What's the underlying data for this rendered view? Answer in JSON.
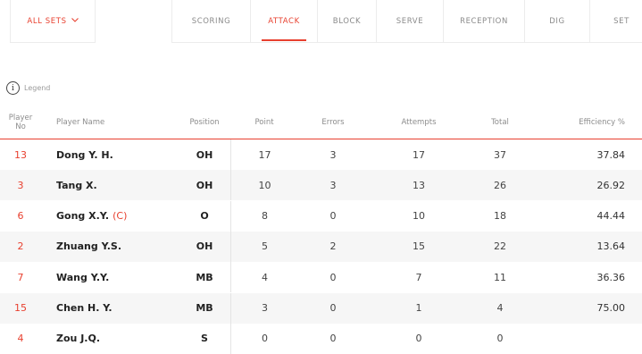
{
  "filter": {
    "label": "ALL SETS"
  },
  "tabs": [
    {
      "label": "SCORING"
    },
    {
      "label": "ATTACK"
    },
    {
      "label": "BLOCK"
    },
    {
      "label": "SERVE"
    },
    {
      "label": "RECEPTION"
    },
    {
      "label": "DIG"
    },
    {
      "label": "SET"
    }
  ],
  "active_tab": "ATTACK",
  "legend": {
    "label": "Legend",
    "icon": "info-icon"
  },
  "columns": {
    "no": "Player No",
    "name": "Player Name",
    "position": "Position",
    "point": "Point",
    "errors": "Errors",
    "attempts": "Attempts",
    "total": "Total",
    "efficiency": "Efficiency %"
  },
  "rows": [
    {
      "no": "13",
      "name": "Dong Y. H.",
      "captain": "",
      "position": "OH",
      "point": "17",
      "errors": "3",
      "attempts": "17",
      "total": "37",
      "efficiency": "37.84"
    },
    {
      "no": "3",
      "name": "Tang X.",
      "captain": "",
      "position": "OH",
      "point": "10",
      "errors": "3",
      "attempts": "13",
      "total": "26",
      "efficiency": "26.92"
    },
    {
      "no": "6",
      "name": "Gong X.Y.",
      "captain": "(C)",
      "position": "O",
      "point": "8",
      "errors": "0",
      "attempts": "10",
      "total": "18",
      "efficiency": "44.44"
    },
    {
      "no": "2",
      "name": "Zhuang Y.S.",
      "captain": "",
      "position": "OH",
      "point": "5",
      "errors": "2",
      "attempts": "15",
      "total": "22",
      "efficiency": "13.64"
    },
    {
      "no": "7",
      "name": "Wang Y.Y.",
      "captain": "",
      "position": "MB",
      "point": "4",
      "errors": "0",
      "attempts": "7",
      "total": "11",
      "efficiency": "36.36"
    },
    {
      "no": "15",
      "name": "Chen H. Y.",
      "captain": "",
      "position": "MB",
      "point": "3",
      "errors": "0",
      "attempts": "1",
      "total": "4",
      "efficiency": "75.00"
    },
    {
      "no": "4",
      "name": "Zou J.Q.",
      "captain": "",
      "position": "S",
      "point": "0",
      "errors": "0",
      "attempts": "0",
      "total": "0",
      "efficiency": ""
    }
  ],
  "colors": {
    "accent": "#e8402f",
    "row_alt": "#f6f6f6"
  }
}
